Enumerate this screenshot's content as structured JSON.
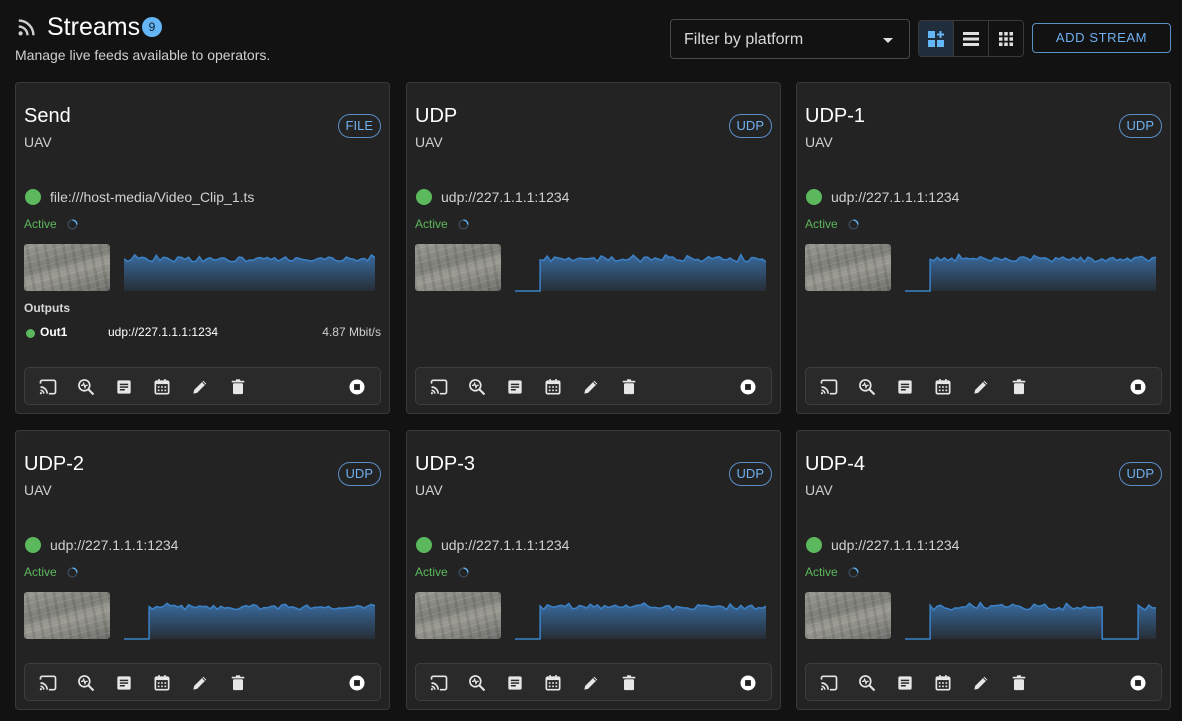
{
  "header": {
    "title": "Streams",
    "count": "9",
    "subtitle": "Manage live feeds available to operators.",
    "filter_placeholder": "Filter by platform",
    "add_stream_label": "ADD STREAM",
    "view_modes": [
      "grid-plus-icon",
      "list-icon",
      "grid-small-icon"
    ],
    "active_view": "grid-plus-icon"
  },
  "colors": {
    "accent": "#64b5f6",
    "active_green": "#5cb85c",
    "chart_fill": "#3a6ea5",
    "chart_line": "#3b82c8"
  },
  "actions": [
    "cast-icon",
    "inspect-icon",
    "notes-icon",
    "schedule-icon",
    "edit-icon",
    "delete-icon",
    "stop-icon"
  ],
  "streams": [
    {
      "name": "Send",
      "platform": "UAV",
      "type": "FILE",
      "url": "file:///host-media/Video_Clip_1.ts",
      "status": "Active",
      "spark_start": 0.0,
      "spark_gaps": [],
      "outputs_heading": "Outputs",
      "outputs": [
        {
          "name": "Out1",
          "url": "udp://227.1.1.1:1234",
          "rate": "4.87 Mbit/s"
        }
      ]
    },
    {
      "name": "UDP",
      "platform": "UAV",
      "type": "UDP",
      "url": "udp://227.1.1.1:1234",
      "status": "Active",
      "spark_start": 0.1,
      "spark_gaps": []
    },
    {
      "name": "UDP-1",
      "platform": "UAV",
      "type": "UDP",
      "url": "udp://227.1.1.1:1234",
      "status": "Active",
      "spark_start": 0.1,
      "spark_gaps": []
    },
    {
      "name": "UDP-2",
      "platform": "UAV",
      "type": "UDP",
      "url": "udp://227.1.1.1:1234",
      "status": "Active",
      "spark_start": 0.1,
      "spark_gaps": []
    },
    {
      "name": "UDP-3",
      "platform": "UAV",
      "type": "UDP",
      "url": "udp://227.1.1.1:1234",
      "status": "Active",
      "spark_start": 0.1,
      "spark_gaps": []
    },
    {
      "name": "UDP-4",
      "platform": "UAV",
      "type": "UDP",
      "url": "udp://227.1.1.1:1234",
      "status": "Active",
      "spark_start": 0.1,
      "spark_gaps": [
        [
          0.8,
          0.92
        ]
      ]
    }
  ]
}
